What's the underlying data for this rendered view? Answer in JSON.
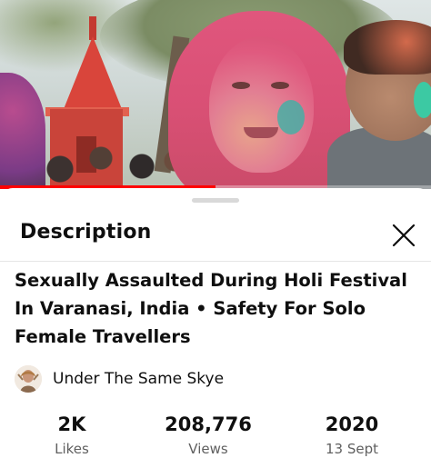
{
  "video": {
    "progress_fraction": 0.5,
    "progress_color": "#ff0000"
  },
  "description_panel": {
    "title": "Description",
    "close_icon": "close-icon"
  },
  "video_title": "Sexually Assaulted During Holi Festival In Varanasi, India • Safety For Solo Female Travellers",
  "channel": {
    "name": "Under The Same Skye",
    "avatar_icon": "channel-avatar"
  },
  "stats": [
    {
      "value": "2K",
      "label": "Likes"
    },
    {
      "value": "208,776",
      "label": "Views"
    },
    {
      "value": "2020",
      "label": "13 Sept"
    }
  ]
}
